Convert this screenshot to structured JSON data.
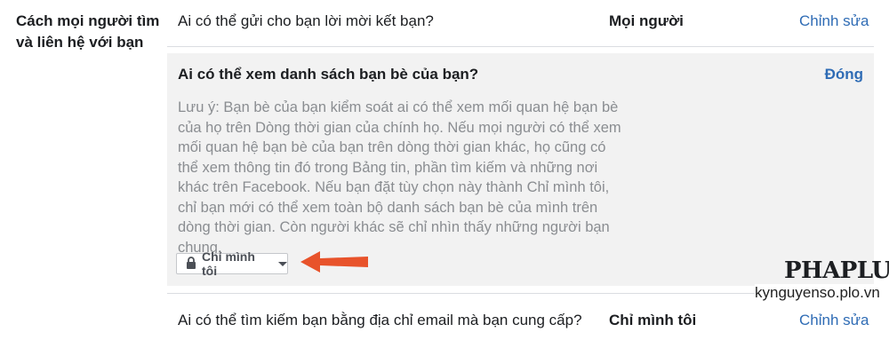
{
  "section": {
    "title": "Cách mọi người tìm và liên hệ với bạn"
  },
  "rows": [
    {
      "question": "Ai có thể gửi cho bạn lời mời kết bạn?",
      "value": "Mọi người",
      "action": "Chỉnh sửa"
    },
    {
      "question": "Ai có thể tìm kiếm bạn bằng địa chỉ email mà bạn cung cấp?",
      "value": "Chỉ mình tôi",
      "action": "Chỉnh sửa"
    }
  ],
  "expanded": {
    "title": "Ai có thể xem danh sách bạn bè của bạn?",
    "close_label": "Đóng",
    "note_lines": [
      "Lưu ý: Bạn bè của bạn kiểm soát ai có thể xem mối quan hệ bạn bè",
      "của họ trên Dòng thời gian của chính họ. Nếu mọi người có thể xem",
      "mối quan hệ bạn bè của bạn trên dòng thời gian khác, họ cũng có",
      "thể xem thông tin đó trong Bảng tin, phần tìm kiếm và những nơi",
      "khác trên Facebook. Nếu bạn đặt tùy chọn này thành Chỉ mình tôi,",
      "chỉ bạn mới có thể xem toàn bộ danh sách bạn bè của mình trên",
      "dòng thời gian. Còn người khác sẽ chỉ nhìn thấy những người bạn",
      "chung."
    ],
    "audience": {
      "selected": "Chỉ mình tôi",
      "icon": "lock-icon"
    }
  },
  "annotation": {
    "arrow_color": "#e8532b"
  },
  "watermark": {
    "logo": "PHAPLUAT",
    "url": "kynguyenso.plo.vn"
  },
  "colors": {
    "link": "#2f6cb5",
    "panel_bg": "#f2f2f2",
    "muted_text": "#8a8d91"
  }
}
